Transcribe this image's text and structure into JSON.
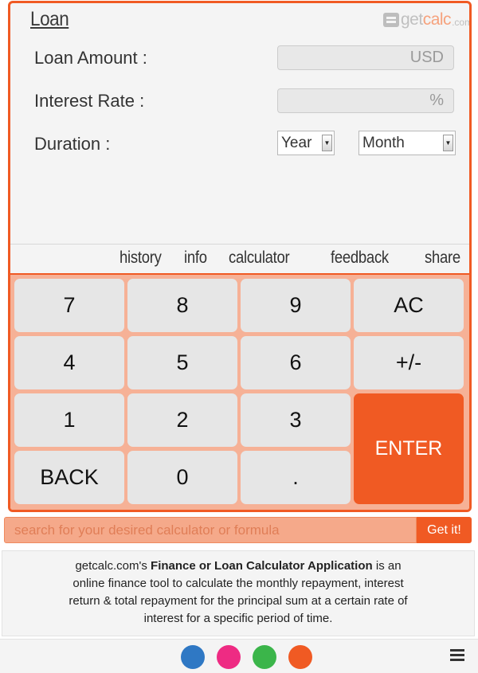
{
  "app": {
    "title": "Loan"
  },
  "logo": {
    "get": "get",
    "calc": "calc",
    "domain": ".com"
  },
  "form": {
    "loan_amount_label": "Loan Amount :",
    "loan_amount_unit": "USD",
    "interest_rate_label": "Interest Rate :",
    "interest_rate_unit": "%",
    "duration_label": "Duration :",
    "year_select": "Year",
    "month_select": "Month"
  },
  "menu": {
    "history": "history",
    "info": "info",
    "calculator": "calculator",
    "feedback": "feedback",
    "share": "share"
  },
  "keys": {
    "k7": "7",
    "k8": "8",
    "k9": "9",
    "ac": "AC",
    "k4": "4",
    "k5": "5",
    "k6": "6",
    "sign": "+/-",
    "k1": "1",
    "k2": "2",
    "k3": "3",
    "enter": "ENTER",
    "back": "BACK",
    "k0": "0",
    "dot": "."
  },
  "search": {
    "placeholder": "search for your desired calculator or formula",
    "button": "Get it!"
  },
  "description": {
    "prefix": "getcalc.com's ",
    "app_name": "Finance or Loan Calculator Application",
    "line1_suffix": " is an",
    "line2": "online finance tool to calculate the monthly repayment, interest",
    "line3": "return & total repayment for the principal sum at a certain rate of",
    "line4": "interest for a specific period of time."
  },
  "theme_dots": [
    "#2f78c4",
    "#ee2b83",
    "#3bb54a",
    "#f05a23"
  ],
  "colors": {
    "accent": "#f05a23",
    "keypad_bg": "#f6b196",
    "key_bg": "#e6e6e6"
  }
}
